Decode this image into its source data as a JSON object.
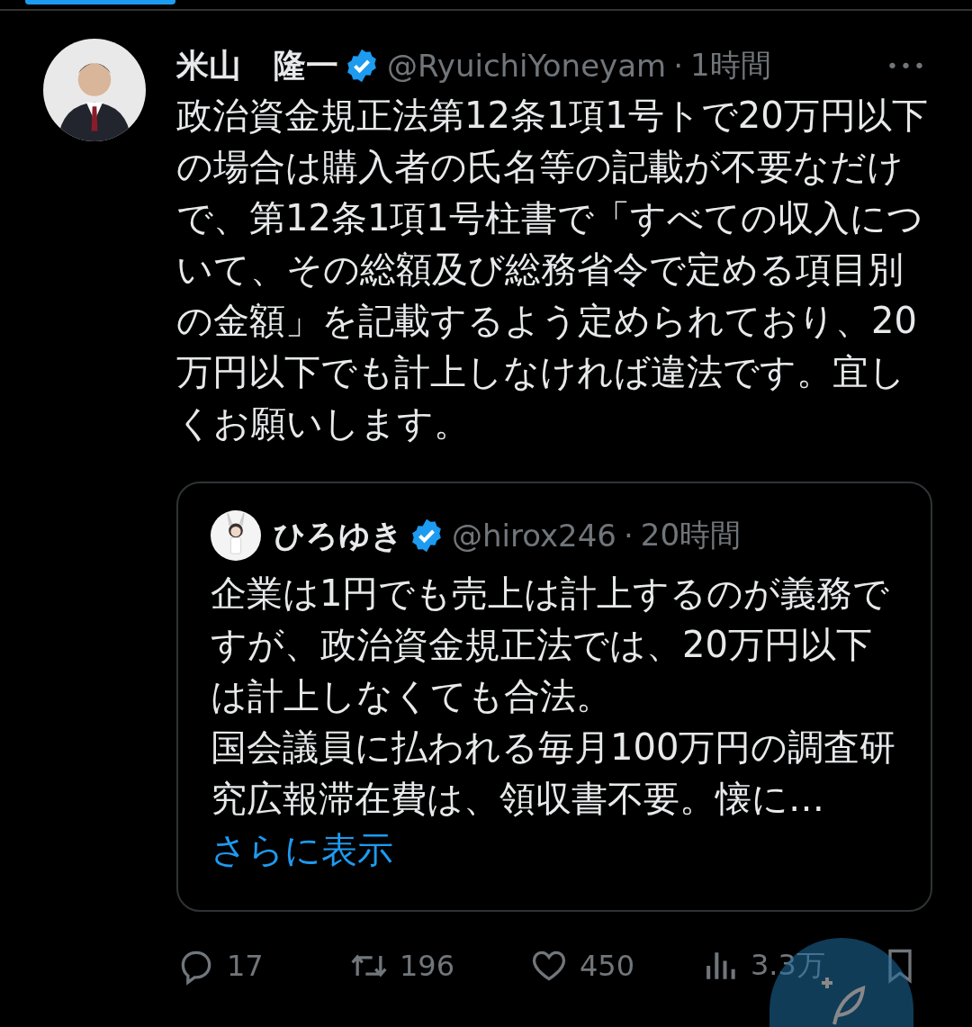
{
  "top_tabs": [
    {
      "selected": true
    }
  ],
  "tweet": {
    "author": {
      "name": "米山　隆一",
      "verified": true,
      "handle": "@RyuichiYoneyam",
      "separator": "·",
      "time": "1時間"
    },
    "more": "•••",
    "body": "政治資金規正法第12条1項1号トで20万円以下の場合は購入者の氏名等の記載が不要なだけで、第12条1項1号柱書で「すべての収入について、その総額及び総務省令で定める項目別の金額」を記載するよう定められており、20万円以下でも計上しなければ違法です。宜しくお願いします。",
    "quote": {
      "author": {
        "name": "ひろゆき",
        "verified": true,
        "handle": "@hirox246",
        "separator": "·",
        "time": "20時間"
      },
      "paragraphs": [
        "企業は1円でも売上は計上するのが義務ですが、政治資金規正法では、20万円以下は計上しなくても合法。",
        "国会議員に払われる毎月100万円の調査研究広報滞在費は、領収書不要。懐に…"
      ],
      "show_more": "さらに表示"
    },
    "actions": [
      {
        "kind": "reply",
        "count": "17"
      },
      {
        "kind": "retweet",
        "count": "196"
      },
      {
        "kind": "like",
        "count": "450"
      },
      {
        "kind": "views",
        "count": "3.3万"
      },
      {
        "kind": "bookmark"
      }
    ]
  }
}
